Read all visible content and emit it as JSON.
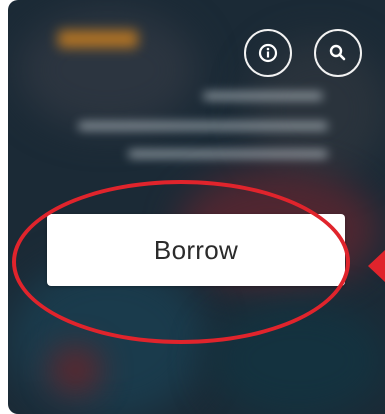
{
  "actions": {
    "borrow_label": "Borrow"
  },
  "icons": {
    "info": "info-icon",
    "search": "search-icon"
  },
  "annotation": {
    "color": "#e0242c"
  }
}
